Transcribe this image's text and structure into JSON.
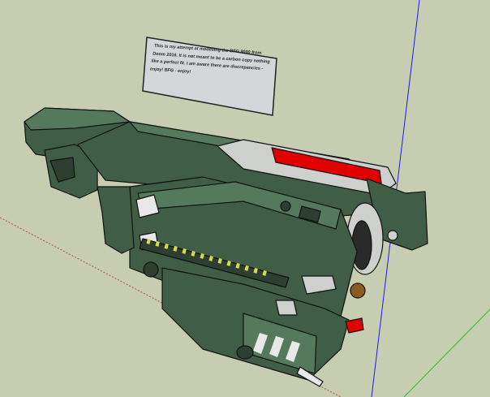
{
  "viewport": {
    "background_color": "#c6cdb1",
    "axes": {
      "blue_axis_color": "#1a1aff",
      "green_axis_color": "#2fbf2f",
      "red_axis_color": "#b5533b"
    }
  },
  "note": {
    "text": "This is my attempt at modelling the BFG 9000 from Doom 2016. It is not meant to be a carbon copy nothing like a perfect fit. I am aware there are discrepancies - enjoy! BFG - enjoy!"
  },
  "model": {
    "name": "BFG 9000 model",
    "body_color": "#3f5e45",
    "dark_color": "#2c3f30",
    "light_color": "#557a5b",
    "accent_red": "#e00000",
    "metal_color": "#cdd0cd",
    "yellow_coil_color": "#d9d94a"
  }
}
